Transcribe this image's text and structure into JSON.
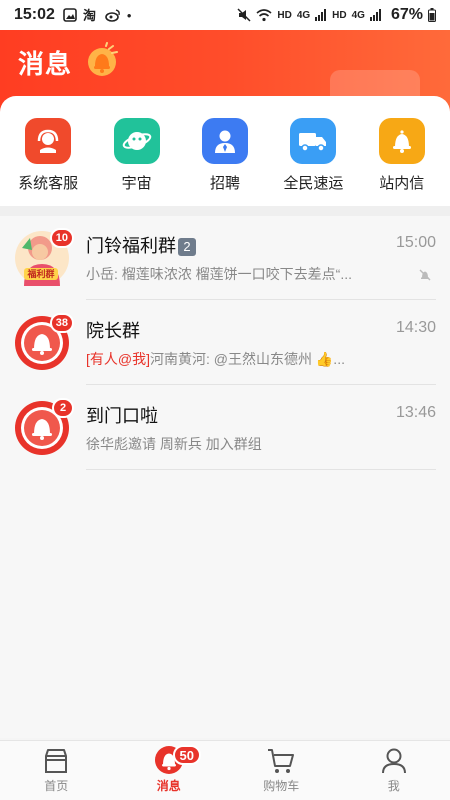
{
  "status_bar": {
    "time": "15:02",
    "app_icons": [
      "gallery-icon",
      "taobao-icon",
      "weibo-icon"
    ],
    "dot": "•",
    "hd1": "HD",
    "net1": "4G",
    "hd2": "HD",
    "net2": "4G",
    "battery": "67%"
  },
  "header": {
    "title": "消息",
    "accent": "#ff4d2a"
  },
  "quick_actions": [
    {
      "label": "系统客服",
      "icon": "headset-icon",
      "color": "#f04a2c"
    },
    {
      "label": "宇宙",
      "icon": "planet-icon",
      "color": "#21c29a"
    },
    {
      "label": "招聘",
      "icon": "person-icon",
      "color": "#3d7bf2"
    },
    {
      "label": "全民速运",
      "icon": "truck-icon",
      "color": "#3a9ef5"
    },
    {
      "label": "站内信",
      "icon": "bell-icon",
      "color": "#f7a815"
    }
  ],
  "messages": [
    {
      "name": "门铃福利群",
      "name_suffix": "2",
      "time": "15:00",
      "preview": "小岳: 榴莲味浓浓 榴莲饼一口咬下去差点“...",
      "count": "10",
      "avatar_label": "福利群"
    },
    {
      "name": "院长群",
      "time": "14:30",
      "mention": "[有人@我]",
      "preview": "河南黄河: @王然山东德州 👍...",
      "count": "38"
    },
    {
      "name": "到门口啦",
      "time": "13:46",
      "preview": "徐华彪邀请 周新兵 加入群组",
      "count": "2"
    }
  ],
  "tabbar": {
    "tabs": [
      {
        "label": "首页",
        "icon": "shop-icon"
      },
      {
        "label": "消息",
        "icon": "doorbell-icon",
        "badge": "50"
      },
      {
        "label": "购物车",
        "icon": "cart-icon"
      },
      {
        "label": "我",
        "icon": "user-icon"
      }
    ]
  }
}
